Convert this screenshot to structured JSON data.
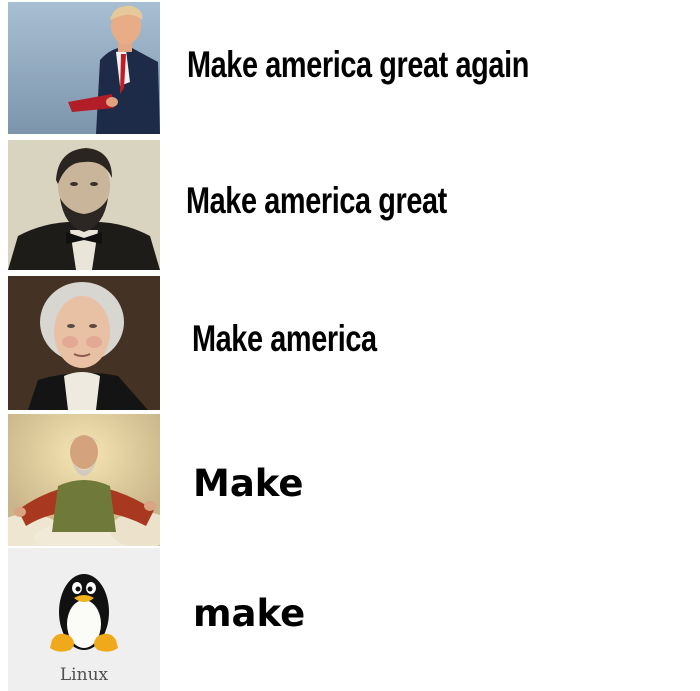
{
  "meme": {
    "rows": [
      {
        "caption": "Make america great again"
      },
      {
        "caption": "Make america great"
      },
      {
        "caption": "Make america"
      },
      {
        "caption": "Make"
      },
      {
        "caption": "make"
      }
    ],
    "linux_logo_text": "Linux"
  }
}
